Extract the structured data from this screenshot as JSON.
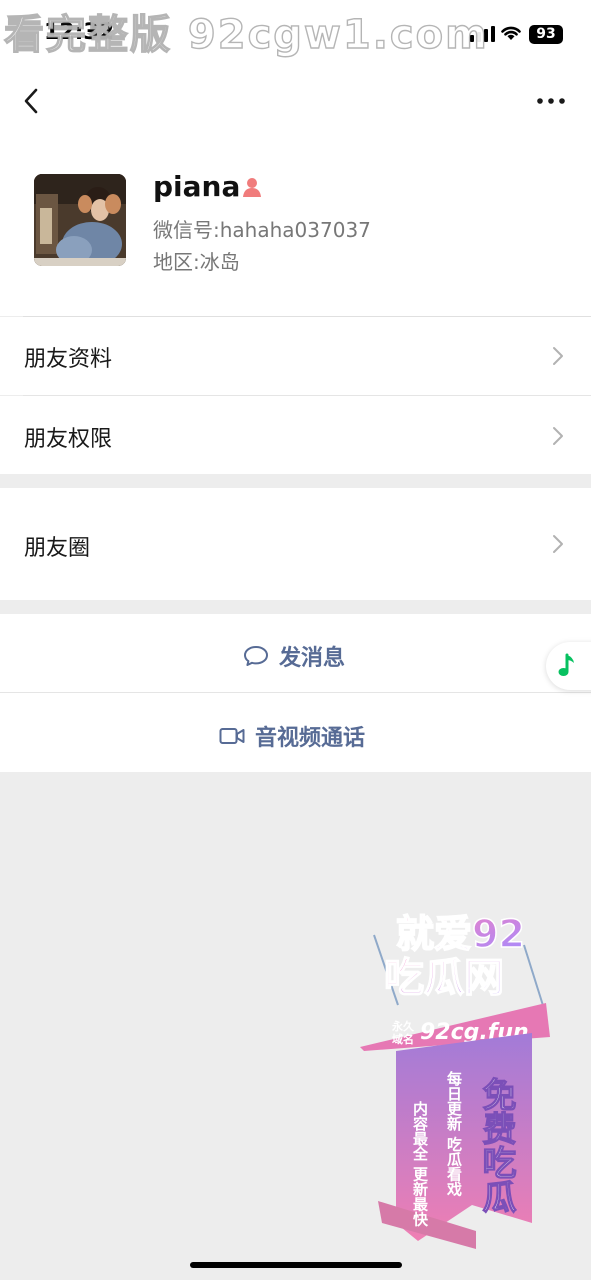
{
  "status_bar": {
    "time": "12:32",
    "battery": "93",
    "watermark": "看完整版 92cgw1.com"
  },
  "profile": {
    "name": "piana",
    "wechat_id_label": "微信号:",
    "wechat_id": "hahaha037037",
    "region_label": "地区:",
    "region": "冰岛",
    "gender_icon": "female-person-icon",
    "gender_color": "#fa5151"
  },
  "menu": {
    "items": [
      {
        "label": "朋友资料"
      },
      {
        "label": "朋友权限"
      },
      {
        "label": "朋友圈"
      }
    ]
  },
  "actions": {
    "send_message": "发消息",
    "video_call": "音视频通话",
    "accent_color": "#576b95"
  },
  "ad": {
    "line1": "就爱92",
    "line2": "吃瓜网",
    "domain_prefix_top": "永久",
    "domain_prefix_bottom": "域名",
    "domain": "92cg.fun",
    "free_label": "免费吃瓜",
    "slogan1": "每日更新 吃瓜看戏",
    "slogan2": "内容最全 更新最快"
  },
  "colors": {
    "background": "#ededed",
    "card": "#ffffff",
    "music_green": "#07c160"
  }
}
